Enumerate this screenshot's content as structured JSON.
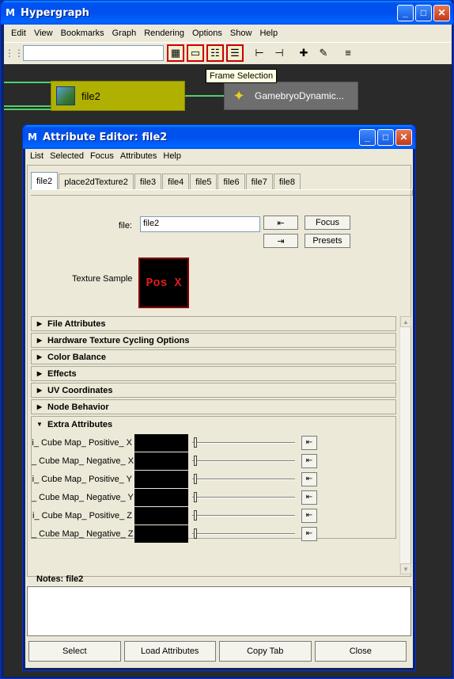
{
  "hypergraph": {
    "title": "Hypergraph",
    "menu": [
      "Edit",
      "View",
      "Bookmarks",
      "Graph",
      "Rendering",
      "Options",
      "Show",
      "Help"
    ],
    "toolbar": {
      "search_value": "",
      "icons": [
        "frame-all-icon",
        "frame-selection-icon",
        "frame-hierarchy-icon",
        "frame-branch-icon",
        "scene-hierarchy-icon",
        "input-output-connections-icon",
        "add-bookmark-icon",
        "bookmark-editor-icon",
        "layout-icon"
      ]
    },
    "tooltip": "Frame Selection",
    "nodes": {
      "file2_label": "file2",
      "gamebryo_label": "GamebryoDynamic..."
    }
  },
  "attribute_editor": {
    "title": "Attribute Editor: file2",
    "menu": [
      "List",
      "Selected",
      "Focus",
      "Attributes",
      "Help"
    ],
    "tabs": [
      "file2",
      "place2dTexture2",
      "file3",
      "file4",
      "file5",
      "file6",
      "file7",
      "file8"
    ],
    "active_tab": "file2",
    "file_label": "file:",
    "file_value": "file2",
    "focus_label": "Focus",
    "presets_label": "Presets",
    "texture_sample_label": "Texture Sample",
    "texture_sample_text": "Pos X",
    "sections": [
      "File Attributes",
      "Hardware Texture Cycling Options",
      "Color Balance",
      "Effects",
      "UV Coordinates",
      "Node Behavior"
    ],
    "extra_title": "Extra Attributes",
    "extra_attrs": [
      {
        "label": "i_ Cube Map_ Positive_ X",
        "value": 0
      },
      {
        "label": "_ Cube Map_ Negative_ X",
        "value": 0
      },
      {
        "label": "i_ Cube Map_ Positive_ Y",
        "value": 0
      },
      {
        "label": "_ Cube Map_ Negative_ Y",
        "value": 0
      },
      {
        "label": "i_ Cube Map_ Positive_ Z",
        "value": 0
      },
      {
        "label": "_ Cube Map_ Negative_ Z",
        "value": 0
      }
    ],
    "notes_title": "Notes: file2",
    "notes_value": "",
    "buttons": {
      "select": "Select",
      "load": "Load Attributes",
      "copy": "Copy Tab",
      "close": "Close"
    }
  },
  "colors": {
    "title_bar": "#0053ee",
    "file_node": "#b0b000",
    "gamebryo_node": "#6e6e6e",
    "connection": "#4fd16a",
    "texture_text": "#e21a1a"
  }
}
